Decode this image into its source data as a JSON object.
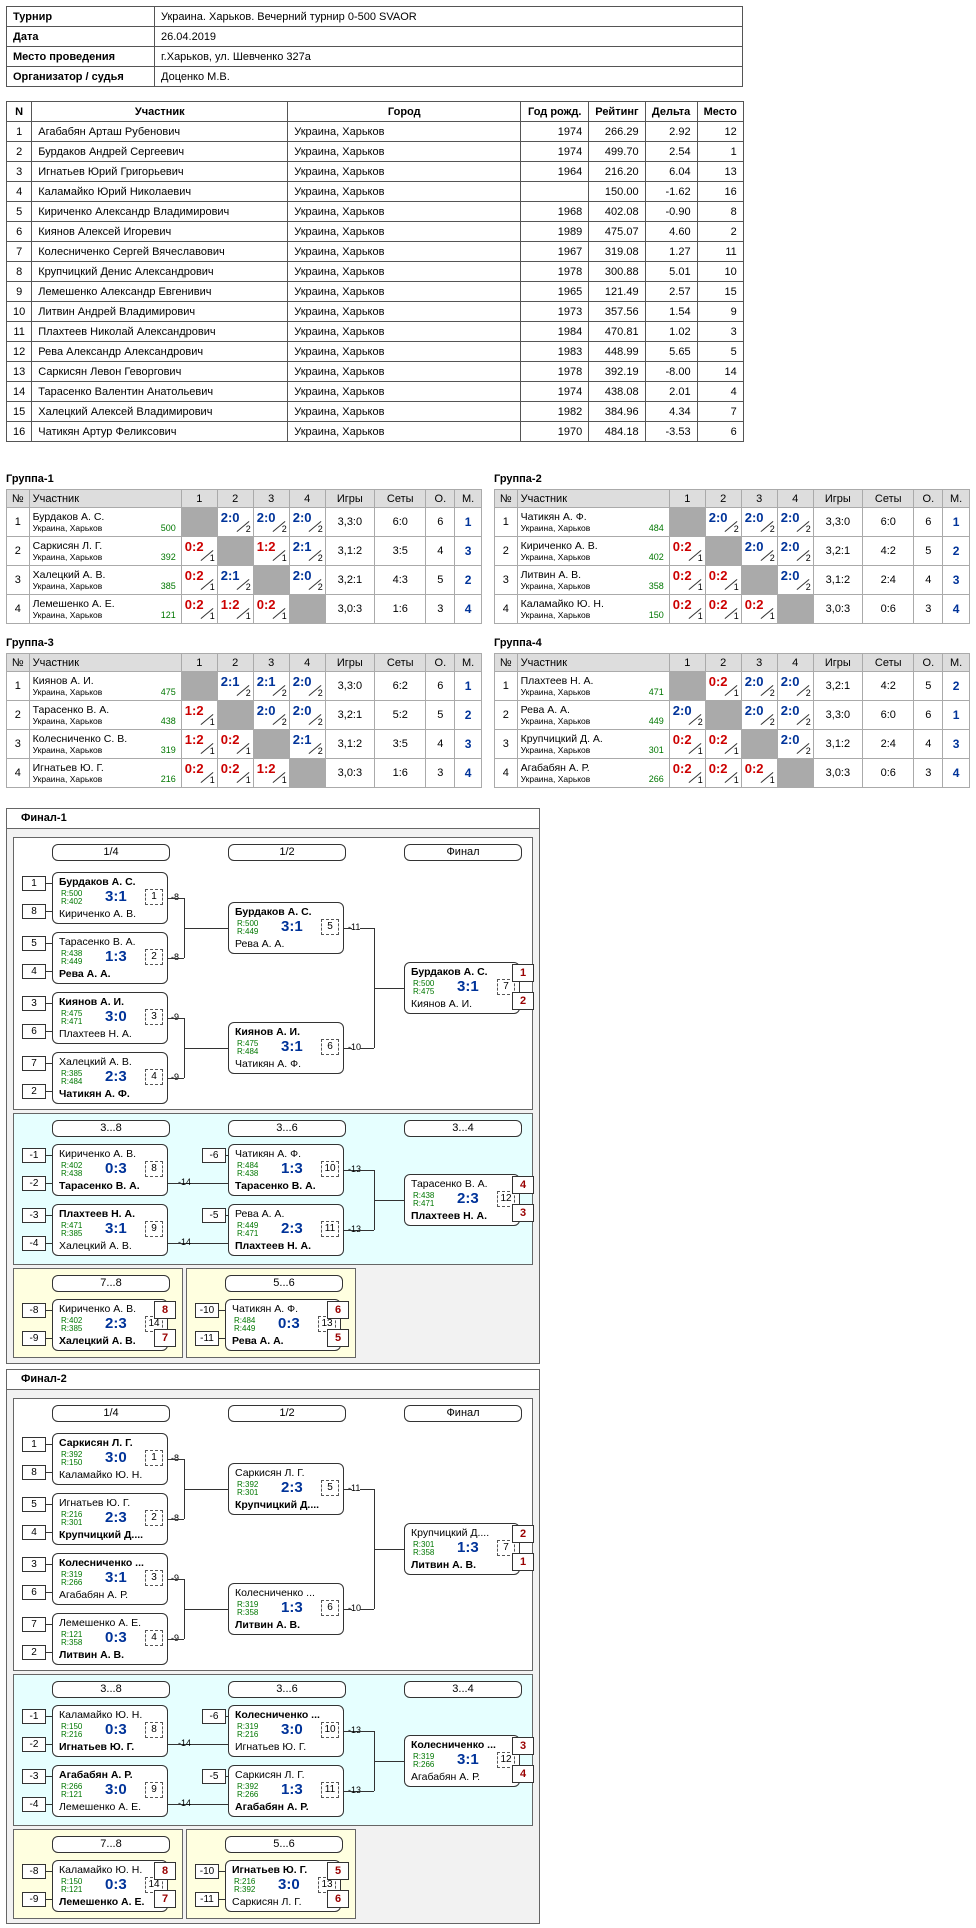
{
  "info": [
    [
      "Турнир",
      "Украина. Харьков. Вечерний турнир 0-500 SVAOR"
    ],
    [
      "Дата",
      "26.04.2019"
    ],
    [
      "Место проведения",
      "г.Харьков, ул.  Шевченко 327а"
    ],
    [
      "Организатор / судья",
      "Доценко М.В."
    ]
  ],
  "plist_head": [
    "N",
    "Участник",
    "Город",
    "Год рожд.",
    "Рейтинг",
    "Дельта",
    "Место"
  ],
  "plist": [
    [
      "1",
      "Агабабян Арташ Рубенович",
      "Украина, Харьков",
      "1974",
      "266.29",
      "2.92",
      "12"
    ],
    [
      "2",
      "Бурдаков Андрей Сергеевич",
      "Украина, Харьков",
      "1974",
      "499.70",
      "2.54",
      "1"
    ],
    [
      "3",
      "Игнатьев Юрий Григорьевич",
      "Украина, Харьков",
      "1964",
      "216.20",
      "6.04",
      "13"
    ],
    [
      "4",
      "Каламайко Юрий Николаевич",
      "Украина, Харьков",
      "",
      "150.00",
      "-1.62",
      "16"
    ],
    [
      "5",
      "Кириченко Александр Владимирович",
      "Украина, Харьков",
      "1968",
      "402.08",
      "-0.90",
      "8"
    ],
    [
      "6",
      "Киянов Алексей Игоревич",
      "Украина, Харьков",
      "1989",
      "475.07",
      "4.60",
      "2"
    ],
    [
      "7",
      "Колесниченко Сергей Вячеславович",
      "Украина, Харьков",
      "1967",
      "319.08",
      "1.27",
      "11"
    ],
    [
      "8",
      "Крупчицкий Денис Александрович",
      "Украина, Харьков",
      "1978",
      "300.88",
      "5.01",
      "10"
    ],
    [
      "9",
      "Лемешенко Александр Евгенивич",
      "Украина, Харьков",
      "1965",
      "121.49",
      "2.57",
      "15"
    ],
    [
      "10",
      "Литвин Андрей Владимирович",
      "Украина, Харьков",
      "1973",
      "357.56",
      "1.54",
      "9"
    ],
    [
      "11",
      "Плахтеев Николай Александрович",
      "Украина, Харьков",
      "1984",
      "470.81",
      "1.02",
      "3"
    ],
    [
      "12",
      "Рева Александр Александрович",
      "Украина, Харьков",
      "1983",
      "448.99",
      "5.65",
      "5"
    ],
    [
      "13",
      "Саркисян Левон Геворгович",
      "Украина, Харьков",
      "1978",
      "392.19",
      "-8.00",
      "14"
    ],
    [
      "14",
      "Тарасенко Валентин Анатольевич",
      "Украина, Харьков",
      "1974",
      "438.08",
      "2.01",
      "4"
    ],
    [
      "15",
      "Халецкий Алексей Владимирович",
      "Украина, Харьков",
      "1982",
      "384.96",
      "4.34",
      "7"
    ],
    [
      "16",
      "Чатикян Артур Феликсович",
      "Украина, Харьков",
      "1970",
      "484.18",
      "-3.53",
      "6"
    ]
  ],
  "group_head": [
    "№",
    "Участник",
    "1",
    "2",
    "3",
    "4",
    "Игры",
    "Сеты",
    "О.",
    "М."
  ],
  "city": "Украина, Харьков",
  "groups": [
    {
      "title": "Группа-1",
      "rows": [
        {
          "n": "1",
          "name": "Бурдаков А. С.",
          "rating": "500",
          "cells": [
            "x",
            [
              "2:0",
              "2"
            ],
            [
              "2:0",
              "2"
            ],
            [
              "2:0",
              "2"
            ]
          ],
          "games": "3,3:0",
          "sets": "6:0",
          "pts": "6",
          "place": "1"
        },
        {
          "n": "2",
          "name": "Саркисян Л. Г.",
          "rating": "392",
          "cells": [
            [
              "0:2",
              "1"
            ],
            "x",
            [
              "1:2",
              "1"
            ],
            [
              "2:1",
              "2"
            ]
          ],
          "games": "3,1:2",
          "sets": "3:5",
          "pts": "4",
          "place": "3"
        },
        {
          "n": "3",
          "name": "Халецкий А. В.",
          "rating": "385",
          "cells": [
            [
              "0:2",
              "1"
            ],
            [
              "2:1",
              "2"
            ],
            "x",
            [
              "2:0",
              "2"
            ]
          ],
          "games": "3,2:1",
          "sets": "4:3",
          "pts": "5",
          "place": "2"
        },
        {
          "n": "4",
          "name": "Лемешенко А. Е.",
          "rating": "121",
          "cells": [
            [
              "0:2",
              "1"
            ],
            [
              "1:2",
              "1"
            ],
            [
              "0:2",
              "1"
            ],
            "x"
          ],
          "games": "3,0:3",
          "sets": "1:6",
          "pts": "3",
          "place": "4"
        }
      ]
    },
    {
      "title": "Группа-2",
      "rows": [
        {
          "n": "1",
          "name": "Чатикян А. Ф.",
          "rating": "484",
          "cells": [
            "x",
            [
              "2:0",
              "2"
            ],
            [
              "2:0",
              "2"
            ],
            [
              "2:0",
              "2"
            ]
          ],
          "games": "3,3:0",
          "sets": "6:0",
          "pts": "6",
          "place": "1"
        },
        {
          "n": "2",
          "name": "Кириченко А. В.",
          "rating": "402",
          "cells": [
            [
              "0:2",
              "1"
            ],
            "x",
            [
              "2:0",
              "2"
            ],
            [
              "2:0",
              "2"
            ]
          ],
          "games": "3,2:1",
          "sets": "4:2",
          "pts": "5",
          "place": "2"
        },
        {
          "n": "3",
          "name": "Литвин А. В.",
          "rating": "358",
          "cells": [
            [
              "0:2",
              "1"
            ],
            [
              "0:2",
              "1"
            ],
            "x",
            [
              "2:0",
              "2"
            ]
          ],
          "games": "3,1:2",
          "sets": "2:4",
          "pts": "4",
          "place": "3"
        },
        {
          "n": "4",
          "name": "Каламайко Ю. Н.",
          "rating": "150",
          "cells": [
            [
              "0:2",
              "1"
            ],
            [
              "0:2",
              "1"
            ],
            [
              "0:2",
              "1"
            ],
            "x"
          ],
          "games": "3,0:3",
          "sets": "0:6",
          "pts": "3",
          "place": "4"
        }
      ]
    },
    {
      "title": "Группа-3",
      "rows": [
        {
          "n": "1",
          "name": "Киянов А. И.",
          "rating": "475",
          "cells": [
            "x",
            [
              "2:1",
              "2"
            ],
            [
              "2:1",
              "2"
            ],
            [
              "2:0",
              "2"
            ]
          ],
          "games": "3,3:0",
          "sets": "6:2",
          "pts": "6",
          "place": "1"
        },
        {
          "n": "2",
          "name": "Тарасенко В. А.",
          "rating": "438",
          "cells": [
            [
              "1:2",
              "1"
            ],
            "x",
            [
              "2:0",
              "2"
            ],
            [
              "2:0",
              "2"
            ]
          ],
          "games": "3,2:1",
          "sets": "5:2",
          "pts": "5",
          "place": "2"
        },
        {
          "n": "3",
          "name": "Колесниченко С. В.",
          "rating": "319",
          "cells": [
            [
              "1:2",
              "1"
            ],
            [
              "0:2",
              "1"
            ],
            "x",
            [
              "2:1",
              "2"
            ]
          ],
          "games": "3,1:2",
          "sets": "3:5",
          "pts": "4",
          "place": "3"
        },
        {
          "n": "4",
          "name": "Игнатьев Ю. Г.",
          "rating": "216",
          "cells": [
            [
              "0:2",
              "1"
            ],
            [
              "0:2",
              "1"
            ],
            [
              "1:2",
              "1"
            ],
            "x"
          ],
          "games": "3,0:3",
          "sets": "1:6",
          "pts": "3",
          "place": "4"
        }
      ]
    },
    {
      "title": "Группа-4",
      "rows": [
        {
          "n": "1",
          "name": "Плахтеев Н. А.",
          "rating": "471",
          "cells": [
            "x",
            [
              "0:2",
              "1"
            ],
            [
              "2:0",
              "2"
            ],
            [
              "2:0",
              "2"
            ]
          ],
          "games": "3,2:1",
          "sets": "4:2",
          "pts": "5",
          "place": "2"
        },
        {
          "n": "2",
          "name": "Рева А. А.",
          "rating": "449",
          "cells": [
            [
              "2:0",
              "2"
            ],
            "x",
            [
              "2:0",
              "2"
            ],
            [
              "2:0",
              "2"
            ]
          ],
          "games": "3,3:0",
          "sets": "6:0",
          "pts": "6",
          "place": "1"
        },
        {
          "n": "3",
          "name": "Крупчицкий Д. А.",
          "rating": "301",
          "cells": [
            [
              "0:2",
              "1"
            ],
            [
              "0:2",
              "1"
            ],
            "x",
            [
              "2:0",
              "2"
            ]
          ],
          "games": "3,1:2",
          "sets": "2:4",
          "pts": "4",
          "place": "3"
        },
        {
          "n": "4",
          "name": "Агабабян А. Р.",
          "rating": "266",
          "cells": [
            [
              "0:2",
              "1"
            ],
            [
              "0:2",
              "1"
            ],
            [
              "0:2",
              "1"
            ],
            "x"
          ],
          "games": "3,0:3",
          "sets": "0:6",
          "pts": "3",
          "place": "4"
        }
      ]
    }
  ],
  "finals": [
    {
      "title": "Финал-1",
      "labels": {
        "r14": "1/4",
        "r12": "1/2",
        "fin": "Финал",
        "r38": "3...8",
        "r36": "3...6",
        "r34": "3...4",
        "r78": "7...8",
        "r56": "5...6"
      },
      "matches": {
        "q1": {
          "p1": "Бурдаков А. С.",
          "p2": "Кириченко А. В.",
          "r1": "R:500",
          "r2": "R:402",
          "s": "3:1",
          "n": "1",
          "w": 1,
          "s1": "1",
          "s2": "8",
          "out": "-8"
        },
        "q2": {
          "p1": "Тарасенко В. А.",
          "p2": "Рева А. А.",
          "r1": "R:438",
          "r2": "R:449",
          "s": "1:3",
          "n": "2",
          "w": 2,
          "s1": "5",
          "s2": "4",
          "out": "-8"
        },
        "q3": {
          "p1": "Киянов А. И.",
          "p2": "Плахтеев Н. А.",
          "r1": "R:475",
          "r2": "R:471",
          "s": "3:0",
          "n": "3",
          "w": 1,
          "s1": "3",
          "s2": "6",
          "out": "-9"
        },
        "q4": {
          "p1": "Халецкий А. В.",
          "p2": "Чатикян А. Ф.",
          "r1": "R:385",
          "r2": "R:484",
          "s": "2:3",
          "n": "4",
          "w": 2,
          "s1": "7",
          "s2": "2",
          "out": "-9"
        },
        "h1": {
          "p1": "Бурдаков А. С.",
          "p2": "Рева А. А.",
          "r1": "R:500",
          "r2": "R:449",
          "s": "3:1",
          "n": "5",
          "w": 1,
          "out": "-11"
        },
        "h2": {
          "p1": "Киянов А. И.",
          "p2": "Чатикян А. Ф.",
          "r1": "R:475",
          "r2": "R:484",
          "s": "3:1",
          "n": "6",
          "w": 1,
          "out": "-10"
        },
        "f": {
          "p1": "Бурдаков А. С.",
          "p2": "Киянов А. И.",
          "r1": "R:500",
          "r2": "R:475",
          "s": "3:1",
          "n": "7",
          "w": 1,
          "pl1": "1",
          "pl2": "2"
        },
        "c1": {
          "p1": "Кириченко А. В.",
          "p2": "Тарасенко В. А.",
          "r1": "R:402",
          "r2": "R:438",
          "s": "0:3",
          "n": "8",
          "w": 2,
          "s1": "-1",
          "s2": "-2",
          "out": "-14"
        },
        "c2": {
          "p1": "Плахтеев Н. А.",
          "p2": "Халецкий А. В.",
          "r1": "R:471",
          "r2": "R:385",
          "s": "3:1",
          "n": "9",
          "w": 1,
          "s1": "-3",
          "s2": "-4",
          "out": "-14"
        },
        "c3": {
          "p1": "Чатикян А. Ф.",
          "p2": "Тарасенко В. А.",
          "r1": "R:484",
          "r2": "R:438",
          "s": "1:3",
          "n": "10",
          "w": 2,
          "s1": "-6",
          "out": "-13"
        },
        "c4": {
          "p1": "Рева А. А.",
          "p2": "Плахтеев Н. А.",
          "r1": "R:449",
          "r2": "R:471",
          "s": "2:3",
          "n": "11",
          "w": 2,
          "s1": "-5",
          "out": "-13"
        },
        "c5": {
          "p1": "Тарасенко В. А.",
          "p2": "Плахтеев Н. А.",
          "r1": "R:438",
          "r2": "R:471",
          "s": "2:3",
          "n": "12",
          "w": 2,
          "pl1": "4",
          "pl2": "3"
        },
        "m78": {
          "p1": "Кириченко А. В.",
          "p2": "Халецкий А. В.",
          "r1": "R:402",
          "r2": "R:385",
          "s": "2:3",
          "n": "14",
          "w": 2,
          "s1": "-8",
          "s2": "-9",
          "pl1": "8",
          "pl2": "7"
        },
        "m56": {
          "p1": "Чатикян А. Ф.",
          "p2": "Рева А. А.",
          "r1": "R:484",
          "r2": "R:449",
          "s": "0:3",
          "n": "13",
          "w": 2,
          "s1": "-10",
          "s2": "-11",
          "pl1": "6",
          "pl2": "5"
        }
      }
    },
    {
      "title": "Финал-2",
      "labels": {
        "r14": "1/4",
        "r12": "1/2",
        "fin": "Финал",
        "r38": "3...8",
        "r36": "3...6",
        "r34": "3...4",
        "r78": "7...8",
        "r56": "5...6"
      },
      "matches": {
        "q1": {
          "p1": "Саркисян Л. Г.",
          "p2": "Каламайко Ю. Н.",
          "r1": "R:392",
          "r2": "R:150",
          "s": "3:0",
          "n": "1",
          "w": 1,
          "s1": "1",
          "s2": "8",
          "out": "-8"
        },
        "q2": {
          "p1": "Игнатьев Ю. Г.",
          "p2": "Крупчицкий Д....",
          "r1": "R:216",
          "r2": "R:301",
          "s": "2:3",
          "n": "2",
          "w": 2,
          "s1": "5",
          "s2": "4",
          "out": "-8"
        },
        "q3": {
          "p1": "Колесниченко ...",
          "p2": "Агабабян А. Р.",
          "r1": "R:319",
          "r2": "R:266",
          "s": "3:1",
          "n": "3",
          "w": 1,
          "s1": "3",
          "s2": "6",
          "out": "-9"
        },
        "q4": {
          "p1": "Лемешенко А. Е.",
          "p2": "Литвин А. В.",
          "r1": "R:121",
          "r2": "R:358",
          "s": "0:3",
          "n": "4",
          "w": 2,
          "s1": "7",
          "s2": "2",
          "out": "-9"
        },
        "h1": {
          "p1": "Саркисян Л. Г.",
          "p2": "Крупчицкий Д....",
          "r1": "R:392",
          "r2": "R:301",
          "s": "2:3",
          "n": "5",
          "w": 2,
          "out": "-11"
        },
        "h2": {
          "p1": "Колесниченко ...",
          "p2": "Литвин А. В.",
          "r1": "R:319",
          "r2": "R:358",
          "s": "1:3",
          "n": "6",
          "w": 2,
          "out": "-10"
        },
        "f": {
          "p1": "Крупчицкий Д....",
          "p2": "Литвин А. В.",
          "r1": "R:301",
          "r2": "R:358",
          "s": "1:3",
          "n": "7",
          "w": 2,
          "pl1": "2",
          "pl2": "1"
        },
        "c1": {
          "p1": "Каламайко Ю. Н.",
          "p2": "Игнатьев Ю. Г.",
          "r1": "R:150",
          "r2": "R:216",
          "s": "0:3",
          "n": "8",
          "w": 2,
          "s1": "-1",
          "s2": "-2",
          "out": "-14"
        },
        "c2": {
          "p1": "Агабабян А. Р.",
          "p2": "Лемешенко А. Е.",
          "r1": "R:266",
          "r2": "R:121",
          "s": "3:0",
          "n": "9",
          "w": 1,
          "s1": "-3",
          "s2": "-4",
          "out": "-14"
        },
        "c3": {
          "p1": "Колесниченко ...",
          "p2": "Игнатьев Ю. Г.",
          "r1": "R:319",
          "r2": "R:216",
          "s": "3:0",
          "n": "10",
          "w": 1,
          "s1": "-6",
          "out": "-13"
        },
        "c4": {
          "p1": "Саркисян Л. Г.",
          "p2": "Агабабян А. Р.",
          "r1": "R:392",
          "r2": "R:266",
          "s": "1:3",
          "n": "11",
          "w": 2,
          "s1": "-5",
          "out": "-13"
        },
        "c5": {
          "p1": "Колесниченко ...",
          "p2": "Агабабян А. Р.",
          "r1": "R:319",
          "r2": "R:266",
          "s": "3:1",
          "n": "12",
          "w": 1,
          "pl1": "3",
          "pl2": "4"
        },
        "m78": {
          "p1": "Каламайко Ю. Н.",
          "p2": "Лемешенко А. Е.",
          "r1": "R:150",
          "r2": "R:121",
          "s": "0:3",
          "n": "14",
          "w": 2,
          "s1": "-8",
          "s2": "-9",
          "pl1": "8",
          "pl2": "7"
        },
        "m56": {
          "p1": "Игнатьев Ю. Г.",
          "p2": "Саркисян Л. Г.",
          "r1": "R:216",
          "r2": "R:392",
          "s": "3:0",
          "n": "13",
          "w": 1,
          "s1": "-10",
          "s2": "-11",
          "pl1": "5",
          "pl2": "6"
        }
      }
    }
  ]
}
